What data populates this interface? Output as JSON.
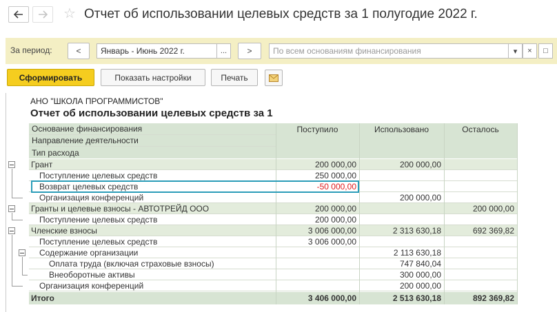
{
  "window": {
    "title": "Отчет об использовании целевых средств за 1 полугодие 2022 г.",
    "back_icon": "arrow-left-icon",
    "forward_icon": "arrow-right-icon",
    "favorite_icon": "star-icon"
  },
  "period": {
    "label": "За период:",
    "prev_label": "<",
    "next_label": ">",
    "value": "Январь - Июнь 2022 г.",
    "select_label": "...",
    "funding_placeholder": "По всем основаниям финансирования",
    "dropdown_label": "▾",
    "clear_label": "×",
    "open_label": "□"
  },
  "toolbar": {
    "generate_label": "Сформировать",
    "settings_label": "Показать настройки",
    "print_label": "Печать",
    "mail_icon": "envelope-icon"
  },
  "report": {
    "company": "АНО \"ШКОЛА ПРОГРАММИСТОВ\"",
    "title": "Отчет об использовании целевых средств за 1 полугодие 2022 г.",
    "header": {
      "dim1": "Основание финансирования",
      "dim2": "Направление деятельности",
      "dim3": "Тип расхода",
      "received": "Поступило",
      "used": "Использовано",
      "remaining": "Осталось"
    },
    "rows": [
      {
        "label": "Грант",
        "received": "200 000,00",
        "used": "200 000,00",
        "remaining": ""
      },
      {
        "label": "Поступление целевых средств",
        "received": "250 000,00",
        "used": "",
        "remaining": ""
      },
      {
        "label": "Возврат целевых средств",
        "received": "-50 000,00",
        "used": "",
        "remaining": ""
      },
      {
        "label": "Организация конференций",
        "received": "",
        "used": "200 000,00",
        "remaining": ""
      },
      {
        "label": "Гранты и целевые взносы - АВТОТРЕЙД ООО",
        "received": "200 000,00",
        "used": "",
        "remaining": "200 000,00"
      },
      {
        "label": "Поступление целевых средств",
        "received": "200 000,00",
        "used": "",
        "remaining": ""
      },
      {
        "label": "Членские взносы",
        "received": "3 006 000,00",
        "used": "2 313 630,18",
        "remaining": "692 369,82"
      },
      {
        "label": "Поступление целевых средств",
        "received": "3 006 000,00",
        "used": "",
        "remaining": ""
      },
      {
        "label": "Содержание организации",
        "received": "",
        "used": "2 113 630,18",
        "remaining": ""
      },
      {
        "label": "Оплата труда (включая страховые взносы)",
        "received": "",
        "used": "747 840,04",
        "remaining": ""
      },
      {
        "label": "Внеоборотные активы",
        "received": "",
        "used": "300 000,00",
        "remaining": ""
      },
      {
        "label": "Организация конференций",
        "received": "",
        "used": "200 000,00",
        "remaining": ""
      }
    ],
    "total": {
      "label": "Итого",
      "received": "3 406 000,00",
      "used": "2 513 630,18",
      "remaining": "892 369,82"
    }
  },
  "colors": {
    "accent": "#f5cd1f",
    "period_bg": "#f4efc4",
    "header_bg": "#d7e4d3",
    "group_bg": "#e3ecdc",
    "negative": "#e0191b",
    "highlight": "#2a9cb8"
  }
}
